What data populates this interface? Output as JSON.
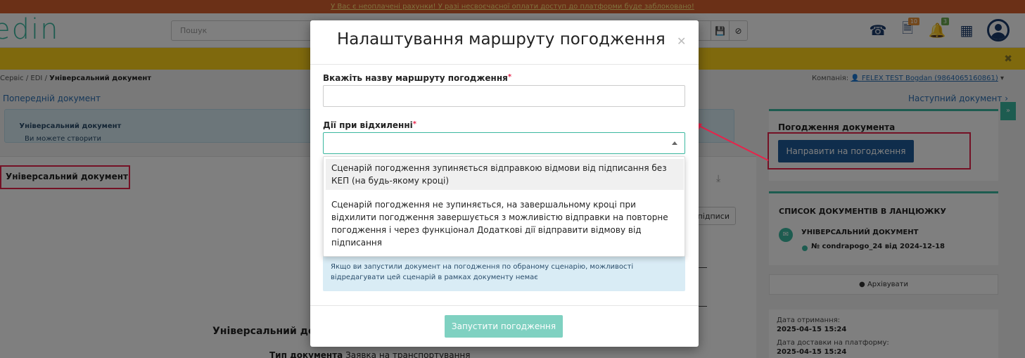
{
  "banner": {
    "text": "У Вас є неоплачені рахунки! У разі несвоєчасної оплати доступ до платформи буде заблоковано!"
  },
  "header": {
    "logo": "edin",
    "search_placeholder": "Пошук",
    "documents_badge": "10",
    "notifications_badge": "3"
  },
  "breadcrumb": {
    "part1": "Сервіс",
    "sep": "/",
    "part2": "EDI",
    "current": "Універсальний документ"
  },
  "company": {
    "label": "Компанія:",
    "name": "FELEX TEST Bogdan (9864065160861)"
  },
  "nav": {
    "prev": "Попередній документ",
    "next": "Наступний документ"
  },
  "info": {
    "text": "Ви можете створити",
    "doc": "Універсальний документ"
  },
  "main": {
    "doc_title": "Універсальний документ",
    "signatures_btn": "підписи",
    "doc_heading": "Універсальний док",
    "doc_type_label": "Тип документа",
    "doc_type_value": "Заявка на транспортування"
  },
  "sidebar": {
    "approval_title": "Погодження документа",
    "approval_btn": "Направити на погодження",
    "chain_title": "СПИСОК ДОКУМЕНТІВ В ЛАНЦЮЖКУ",
    "chain_doc": "УНІВЕРСАЛЬНИЙ ДОКУМЕНТ",
    "chain_num": "№ condrapogo_24 від 2024-12-18",
    "archive_btn": "Архівувати",
    "received_label": "Дата отримання:",
    "received_value": "2025-04-15 15:24",
    "delivery_label": "Дата доставки на платформу:",
    "delivery_value": "2025-04-15 15:24"
  },
  "modal": {
    "title": "Налаштування маршруту погодження",
    "name_label": "Вкажіть назву маршруту погодження",
    "name_value": "",
    "reject_label": "Дії при відхиленні",
    "req_mark": "*",
    "options": [
      "Сценарій погодження зупиняється відправкою відмови від підписання без КЕП (на будь-якому кроці)",
      "Сценарій погодження не зупиняється, на завершальному кроці при відхилити погодження завершується з можливістю відправки на повторне погодження і через функціонал Додаткові дії відправити відмову від підписання"
    ],
    "notice": "Якщо ви запустили документ на погодження по обраному сценарію, можливості відредагувати цей сценарій в рамках документу немає",
    "start_btn": "Запустити погодження"
  },
  "colors": {
    "brand": "#3bb8a0",
    "primary": "#1f5b99",
    "highlight": "#e8234a",
    "warning": "#ffd21a"
  }
}
